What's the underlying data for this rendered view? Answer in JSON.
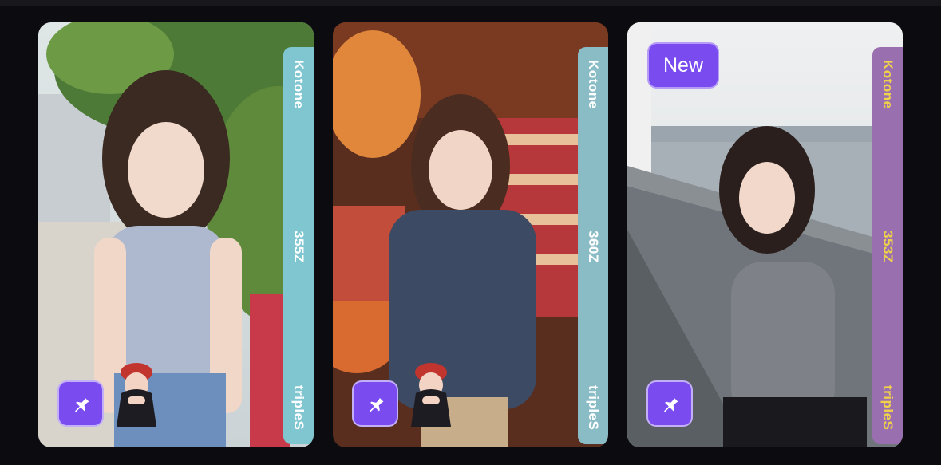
{
  "cards": [
    {
      "band": {
        "member": "Kotone",
        "serial": "355Z",
        "group": "tripleS"
      },
      "colors": {
        "band": "#7fc6d1",
        "band_text": "#ffffff"
      },
      "new_label": ""
    },
    {
      "band": {
        "member": "Kotone",
        "serial": "360Z",
        "group": "tripleS"
      },
      "colors": {
        "band": "#8abcc6",
        "band_text": "#ffffff"
      },
      "new_label": ""
    },
    {
      "band": {
        "member": "Kotone",
        "serial": "353Z",
        "group": "tripleS"
      },
      "colors": {
        "band": "#9a6fb0",
        "band_text": "#f0d24a"
      },
      "new_label": "New"
    }
  ],
  "icons": {
    "pin": "pushpin-icon",
    "avatar": "avatar-sticker"
  },
  "accent": "#7a4cf0"
}
